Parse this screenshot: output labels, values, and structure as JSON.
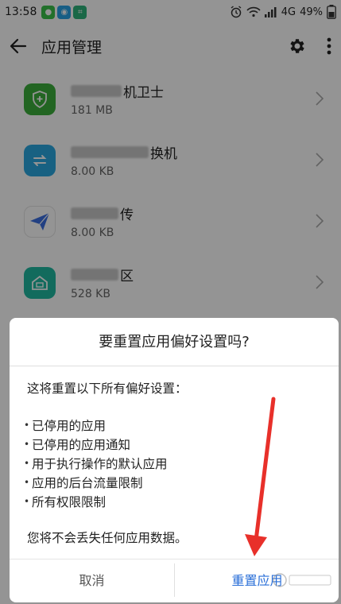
{
  "status_bar": {
    "time": "13:58",
    "network": "4G",
    "battery": "49%"
  },
  "app_bar": {
    "title": "应用管理"
  },
  "apps": [
    {
      "name_visible": "机卫士",
      "size": "181 MB",
      "icon_color": "#3cae3c"
    },
    {
      "name_visible": "换机",
      "size": "8.00 KB",
      "icon_color": "#2aa8e0"
    },
    {
      "name_visible": "传",
      "size": "8.00 KB",
      "icon_color": "#3b6fe0"
    },
    {
      "name_visible": "区",
      "size": "528 KB",
      "icon_color": "#1fb8a0"
    }
  ],
  "dialog": {
    "title": "要重置应用偏好设置吗?",
    "intro": "这将重置以下所有偏好设置：",
    "bullets": [
      "已停用的应用",
      "已停用的应用通知",
      "用于执行操作的默认应用",
      "应用的后台流量限制",
      "所有权限限制"
    ],
    "note": "您将不会丢失任何应用数据。",
    "cancel_label": "取消",
    "confirm_label": "重置应用"
  },
  "colors": {
    "accent": "#2a6fd8",
    "annotation_arrow": "#e8302a"
  }
}
